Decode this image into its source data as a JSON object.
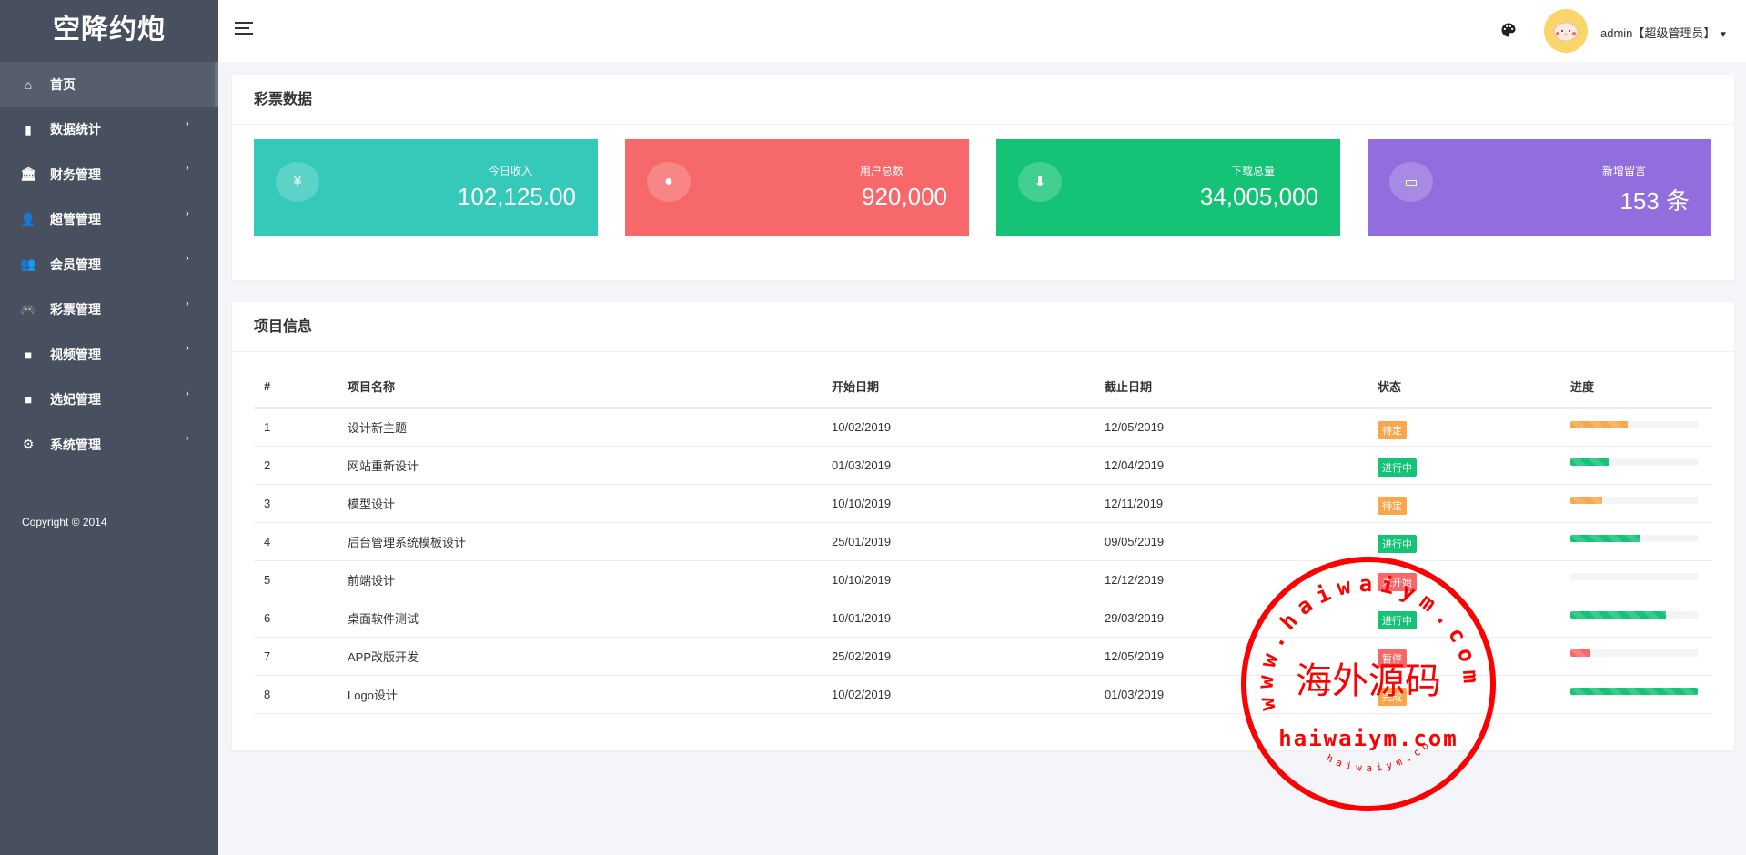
{
  "sidebar": {
    "logo": "空降约炮",
    "items": [
      {
        "label": "首页",
        "icon": "home-icon",
        "active": true
      },
      {
        "label": "数据统计",
        "icon": "bar-chart-icon"
      },
      {
        "label": "财务管理",
        "icon": "bank-icon"
      },
      {
        "label": "超管管理",
        "icon": "user-icon"
      },
      {
        "label": "会员管理",
        "icon": "users-icon"
      },
      {
        "label": "彩票管理",
        "icon": "gamepad-icon"
      },
      {
        "label": "视频管理",
        "icon": "video-icon"
      },
      {
        "label": "选妃管理",
        "icon": "video-icon"
      },
      {
        "label": "系统管理",
        "icon": "gear-icon"
      }
    ],
    "copyright": "Copyright © 2014"
  },
  "header": {
    "user": "admin【超级管理员】",
    "menu_icon": "hamburger-icon",
    "theme_icon": "palette-icon"
  },
  "stats": {
    "title": "彩票数据",
    "cards": [
      {
        "label": "今日收入",
        "value": "102,125.00",
        "icon": "¥",
        "color": "#34c9b9"
      },
      {
        "label": "用户总数",
        "value": "920,000",
        "icon": "user-icon",
        "color": "#f7686a"
      },
      {
        "label": "下载总量",
        "value": "34,005,000",
        "icon": "download-icon",
        "color": "#15c377"
      },
      {
        "label": "新增留言",
        "value": "153 条",
        "icon": "comment-icon",
        "color": "#926dde"
      }
    ]
  },
  "projects": {
    "title": "项目信息",
    "columns": [
      "#",
      "项目名称",
      "开始日期",
      "截止日期",
      "状态",
      "进度"
    ],
    "rows": [
      {
        "id": "1",
        "name": "设计新主题",
        "start": "10/02/2019",
        "end": "12/05/2019",
        "status": "待定",
        "status_color": "#faa64b",
        "progress": 45,
        "bar_color": "#faa64b"
      },
      {
        "id": "2",
        "name": "网站重新设计",
        "start": "01/03/2019",
        "end": "12/04/2019",
        "status": "进行中",
        "status_color": "#15c377",
        "progress": 30,
        "bar_color": "#15c377"
      },
      {
        "id": "3",
        "name": "模型设计",
        "start": "10/10/2019",
        "end": "12/11/2019",
        "status": "待定",
        "status_color": "#faa64b",
        "progress": 25,
        "bar_color": "#faa64b"
      },
      {
        "id": "4",
        "name": "后台管理系统模板设计",
        "start": "25/01/2019",
        "end": "09/05/2019",
        "status": "进行中",
        "status_color": "#15c377",
        "progress": 55,
        "bar_color": "#15c377"
      },
      {
        "id": "5",
        "name": "前端设计",
        "start": "10/10/2019",
        "end": "12/12/2019",
        "status": "未开始",
        "status_color": "#f96868",
        "progress": 0,
        "bar_color": "#f96868"
      },
      {
        "id": "6",
        "name": "桌面软件测试",
        "start": "10/01/2019",
        "end": "29/03/2019",
        "status": "进行中",
        "status_color": "#15c377",
        "progress": 75,
        "bar_color": "#15c377"
      },
      {
        "id": "7",
        "name": "APP改版开发",
        "start": "25/02/2019",
        "end": "12/05/2019",
        "status": "暂停",
        "status_color": "#f96868",
        "progress": 15,
        "bar_color": "#f96868"
      },
      {
        "id": "8",
        "name": "Logo设计",
        "start": "10/02/2019",
        "end": "01/03/2019",
        "status": "完成",
        "status_color": "#faa64b",
        "progress": 100,
        "bar_color": "#15c377"
      }
    ]
  },
  "watermark": {
    "center": "海外源码",
    "arc": "www.haiwaiym.com",
    "bottom": "haiwaiym.com",
    "small": "haiwaiym.com"
  }
}
